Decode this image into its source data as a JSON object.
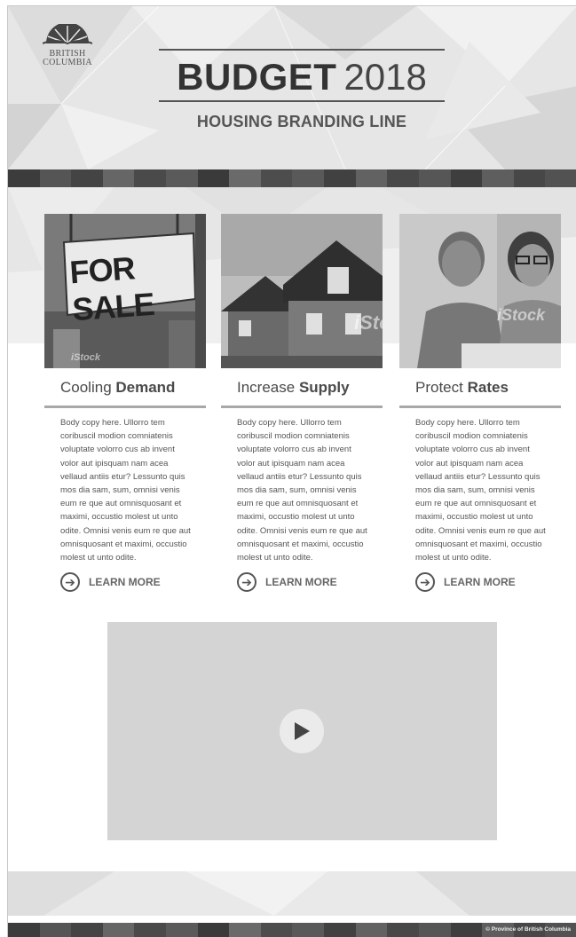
{
  "header": {
    "logo_line1": "British",
    "logo_line2": "Columbia",
    "title_bold": "BUDGET",
    "title_year": "2018",
    "subtitle": "HOUSING BRANDING LINE"
  },
  "columns": [
    {
      "heading_light": "Cooling ",
      "heading_bold": "Demand",
      "photo_text": "FOR SALE",
      "watermark": "iStock",
      "body": "Body copy here. Ullorro tem coribuscil modion comniatenis voluptate volorro cus ab invent volor aut ipisquam nam acea vellaud antiis etur? Lessunto quis mos dia sam, sum, omnisi venis eum re que aut omnisquosant et maximi, occustio molest ut unto odite. Omnisi venis eum re que aut omnisquosant et maximi, occustio molest ut unto odite.",
      "cta": "LEARN MORE"
    },
    {
      "heading_light": "Increase ",
      "heading_bold": "Supply",
      "watermark": "iStock",
      "body": "Body copy here. Ullorro tem coribuscil modion comniatenis voluptate volorro cus ab invent volor aut ipisquam nam acea vellaud antiis etur? Lessunto quis mos dia sam, sum, omnisi venis eum re que aut omnisquosant et maximi, occustio molest ut unto odite. Omnisi venis eum re que aut omnisquosant et maximi, occustio molest ut unto odite.",
      "cta": "LEARN MORE"
    },
    {
      "heading_light": "Protect ",
      "heading_bold": "Rates",
      "watermark": "iStock",
      "body": "Body copy here. Ullorro tem coribuscil modion comniatenis voluptate volorro cus ab invent volor aut ipisquam nam acea vellaud antiis etur? Lessunto quis mos dia sam, sum, omnisi venis eum re que aut omnisquosant et maximi, occustio molest ut unto odite. Omnisi venis eum re que aut omnisquosant et maximi, occustio molest ut unto odite.",
      "cta": "LEARN MORE"
    }
  ],
  "video": {
    "play_icon": "play-icon"
  },
  "footer": {
    "copyright": "© Province of British Columbia"
  },
  "colors": {
    "page_bg": "#ffffff",
    "hero_bg": "#e6e6e6",
    "stripe_dark": "#3a3a3a",
    "text_dark": "#333333",
    "video_bg": "#d4d4d4"
  }
}
